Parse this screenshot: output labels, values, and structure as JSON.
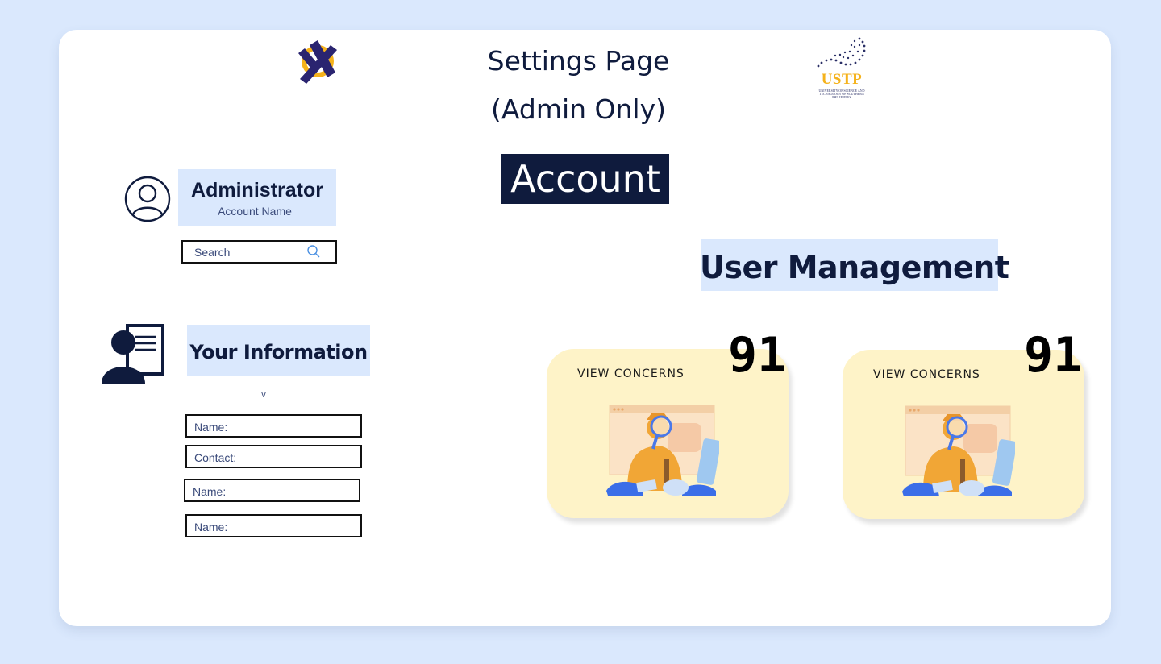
{
  "header": {
    "title_line1": "Settings Page",
    "title_line2": "(Admin Only)",
    "logo_left": "app-logo-icon",
    "logo_right_text": "USTP",
    "logo_right_subtext": "UNIVERSITY OF SCIENCE AND TECHNOLOGY OF SOUTHERN PHILIPPINES"
  },
  "section_title": "Account",
  "admin": {
    "role": "Administrator",
    "account_name": "Account Name",
    "icon": "user-circle-icon"
  },
  "search": {
    "placeholder": "Search",
    "icon": "search-icon"
  },
  "your_information": {
    "title": "Your Information",
    "toggle": "v",
    "icon": "profile-card-icon",
    "fields": [
      "Name:",
      "Contact:",
      "Name:",
      "Name:"
    ]
  },
  "user_management": {
    "title": "User Management",
    "cards": [
      {
        "label": "VIEW CONCERNS",
        "count": "91"
      },
      {
        "label": "VIEW CONCERNS",
        "count": "91"
      }
    ]
  },
  "colors": {
    "background": "#dae8fd",
    "navy": "#0f1b3d",
    "card_yellow": "#fef3c8",
    "accent_orange": "#f5b21b"
  }
}
